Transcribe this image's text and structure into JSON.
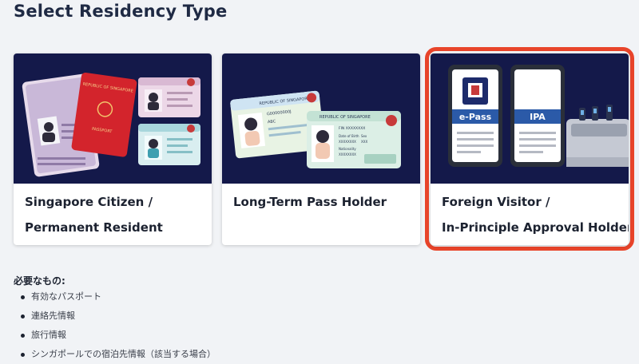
{
  "page": {
    "title": "Select Residency Type"
  },
  "cards": [
    {
      "line1": "Singapore Citizen /",
      "line2": "Permanent Resident",
      "selected": false
    },
    {
      "line1": "Long-Term Pass Holder",
      "line2": "",
      "selected": false
    },
    {
      "line1": "Foreign Visitor /",
      "line2": "In-Principle Approval Holder",
      "selected": true
    }
  ],
  "card_art": {
    "passport_text": "REPUBLIC OF SINGAPORE",
    "passport_word": "PASSPORT",
    "ltp_header": "REPUBLIC OF SINGAPORE",
    "ltp_number": "G00000000J",
    "ltp_name": "ABC",
    "ltp_back_header": "REPUBLIC OF SINGAPORE",
    "ltp_back_number": "FIN XXXXXXXX",
    "ltp_field_dob": "Date of Birth",
    "ltp_field_sex": "Sex",
    "ltp_field_nat": "Nationality",
    "ltp_value_dob": "XXXXXXXX",
    "ltp_value_sex": "XXX",
    "ltp_value_nat": "XXXXXXXX",
    "epass_label": "e-Pass",
    "ipa_label": "IPA"
  },
  "requirements": {
    "title": "必要なもの:",
    "items": [
      "有効なパスポート",
      "連絡先情報",
      "旅行情報",
      "シンガポールでの宿泊先情報（該当する場合）"
    ]
  },
  "colors": {
    "background": "#f1f3f6",
    "card_image_bg": "#14194a",
    "selected_ring": "#e8442a",
    "passport_red": "#d3242c",
    "pass_blue": "#2b5aa8"
  }
}
